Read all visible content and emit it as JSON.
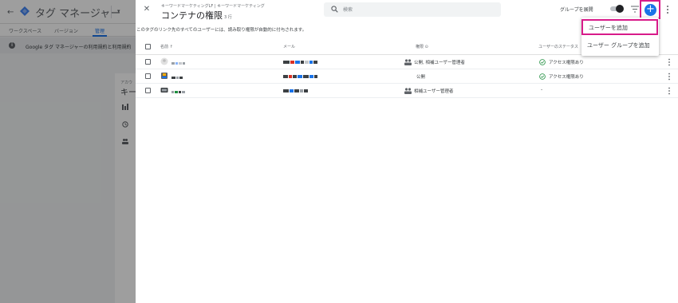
{
  "background": {
    "app_title": "タグ マネージャー",
    "tabs": [
      {
        "label": "ワークスペース"
      },
      {
        "label": "バージョン"
      },
      {
        "label": "管理"
      }
    ],
    "notice": "Google タグ マネージャーの利用規約と利用規約",
    "card_label": "アカウ",
    "card_title": "キー"
  },
  "panel": {
    "breadcrumb": "キーワードマーケティングLF | キーワードマーケティング",
    "title": "コンテナの権限",
    "count": "3 行",
    "search_placeholder": "検索",
    "group_expand_label": "グループを展開",
    "info": "このタグのリンク先のすべてのユーザーには、読み取り権限が自動的に付与されます。",
    "columns": {
      "name": "名前 ↑",
      "email": "メール",
      "role": "権限 ⊙",
      "status": "ユーザーのステータス"
    },
    "rows": [
      {
        "role": "公開, 相補ユーザー管理者",
        "status": "アクセス権限あり",
        "has_status": true
      },
      {
        "role": "公開",
        "status": "アクセス権限あり",
        "has_status": true
      },
      {
        "role": "相補ユーザー管理者",
        "status": "-",
        "has_status": false
      }
    ]
  },
  "menu": {
    "items": [
      {
        "label": "ユーザーを追加"
      },
      {
        "label": "ユーザー グループを追加"
      }
    ]
  },
  "colors": {
    "accent": "#1a73e8",
    "highlight": "#d81b8a",
    "success": "#1e8e3e"
  }
}
